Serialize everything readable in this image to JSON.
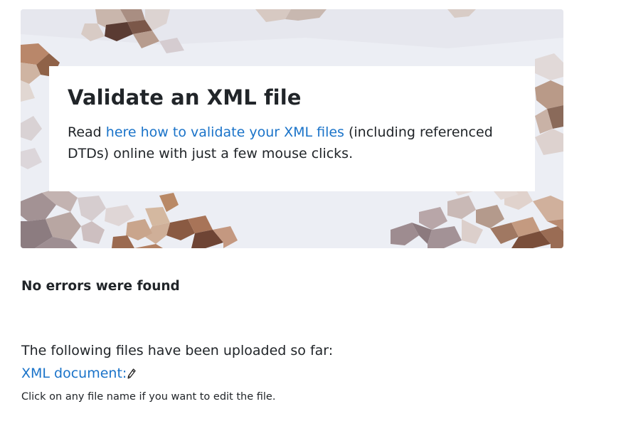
{
  "hero": {
    "title": "Validate an XML file",
    "text_prefix": "Read ",
    "link_text": "here how to validate your XML files",
    "text_suffix": " (including referenced DTDs) online with just a few mouse clicks."
  },
  "result": {
    "status": "No errors were found"
  },
  "uploads": {
    "intro": "The following files have been uploaded so far:",
    "file_link": "XML document:",
    "edit_icon": "pencil-icon",
    "hint": "Click on any file name if you want to edit the file."
  },
  "colors": {
    "link": "#1a73c9",
    "text": "#212529",
    "hero_background": "#eceef4"
  }
}
